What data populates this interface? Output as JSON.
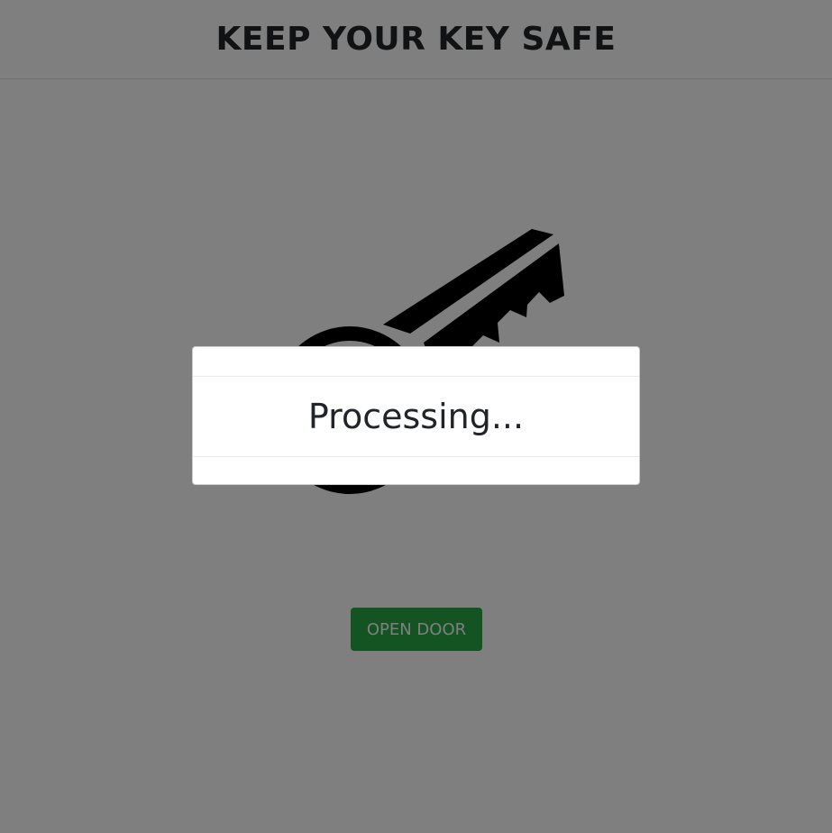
{
  "header": {
    "title": "KEEP YOUR KEY SAFE"
  },
  "main": {
    "key_icon": "key-icon",
    "open_button_label": "OPEN DOOR",
    "button_color": "#28a745"
  },
  "modal": {
    "message": "Processing..."
  }
}
